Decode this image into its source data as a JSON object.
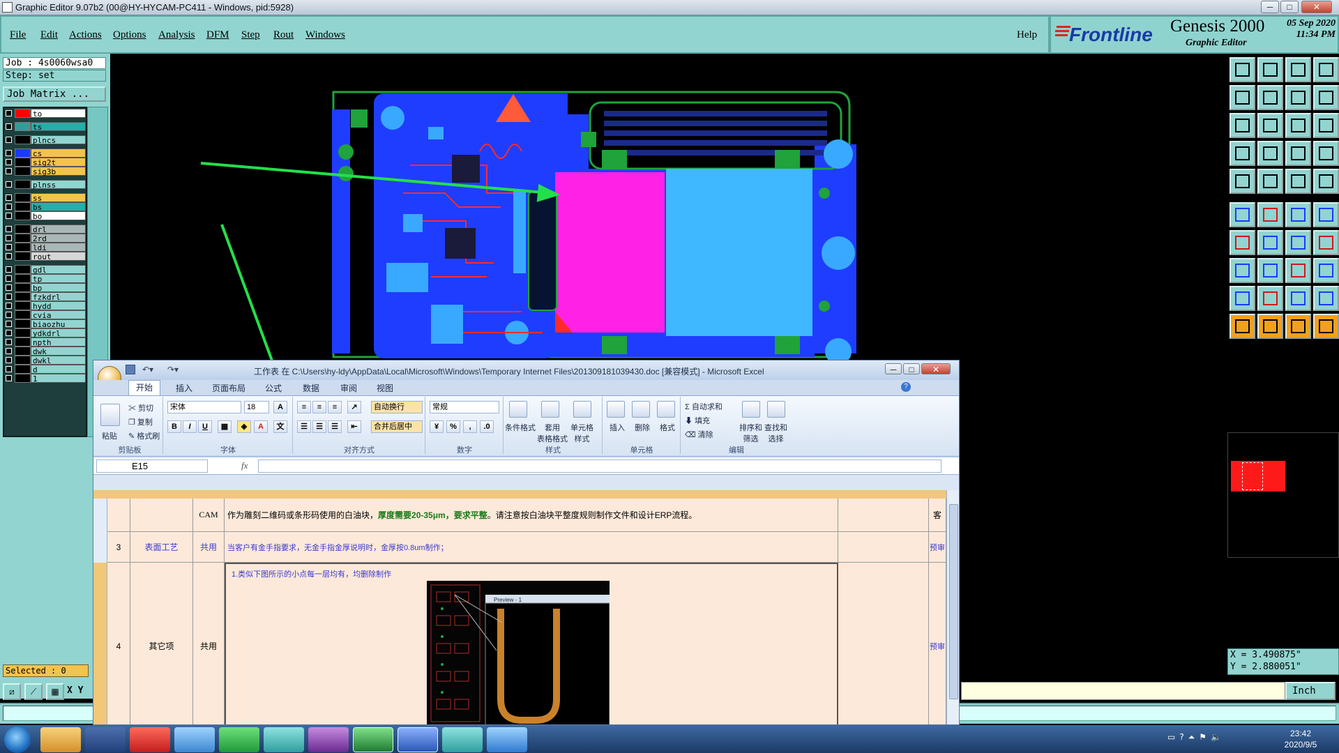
{
  "window": {
    "title": "Graphic Editor 9.07b2 (00@HY-HYCAM-PC411 - Windows, pid:5928)",
    "minimize": "─",
    "maximize": "□",
    "close": "✕"
  },
  "menu": {
    "items": [
      "File",
      "Edit",
      "Actions",
      "Options",
      "Analysis",
      "DFM",
      "Step",
      "Rout",
      "Windows"
    ],
    "help": "Help"
  },
  "brand": {
    "logo_text": "Frontline",
    "product": "Genesis 2000",
    "subtitle": "Graphic Editor",
    "date": "05  Sep  2020",
    "time": "11:34  PM"
  },
  "job": {
    "job_line": "Job : 4s0060wsa0",
    "step_line": "Step: set",
    "matrix_button": "Job Matrix ..."
  },
  "layers": [
    {
      "name": "to",
      "color": "#ff0000",
      "bg": "#ffffff"
    },
    {
      "name": "ts",
      "color": "#2aa198",
      "bg": "#22b0a8"
    },
    {
      "name": "plncs",
      "color": "#000000",
      "bg": "#92d4d0"
    },
    {
      "name": "cs",
      "color": "#1a3aff",
      "bg": "#f2c44e"
    },
    {
      "name": "sig2t",
      "color": "#000000",
      "bg": "#f2c44e"
    },
    {
      "name": "sig3b",
      "color": "#000000",
      "bg": "#f2c44e"
    },
    {
      "name": "plnss",
      "color": "#000000",
      "bg": "#92d4d0"
    },
    {
      "name": "ss",
      "color": "#000000",
      "bg": "#f2c44e"
    },
    {
      "name": "bs",
      "color": "#000000",
      "bg": "#22b0a8"
    },
    {
      "name": "bo",
      "color": "#000000",
      "bg": "#ffffff"
    },
    {
      "name": "drl",
      "color": "#000000",
      "bg": "#a9b7b6"
    },
    {
      "name": "2rd",
      "color": "#000000",
      "bg": "#a9b7b6"
    },
    {
      "name": "ldi",
      "color": "#000000",
      "bg": "#a9b7b6"
    },
    {
      "name": "rout",
      "color": "#000000",
      "bg": "#d6d6d6"
    },
    {
      "name": "gdl",
      "color": "#000000",
      "bg": "#92d4d0"
    },
    {
      "name": "tp",
      "color": "#000000",
      "bg": "#92d4d0"
    },
    {
      "name": "bp",
      "color": "#000000",
      "bg": "#92d4d0"
    },
    {
      "name": "fzkdrl",
      "color": "#000000",
      "bg": "#92d4d0"
    },
    {
      "name": "hydd",
      "color": "#000000",
      "bg": "#92d4d0"
    },
    {
      "name": "cvia",
      "color": "#000000",
      "bg": "#92d4d0"
    },
    {
      "name": "biaozhu",
      "color": "#000000",
      "bg": "#92d4d0"
    },
    {
      "name": "ydkdrl",
      "color": "#000000",
      "bg": "#92d4d0"
    },
    {
      "name": "npth",
      "color": "#000000",
      "bg": "#92d4d0"
    },
    {
      "name": "dwk",
      "color": "#000000",
      "bg": "#92d4d0"
    },
    {
      "name": "dwkl",
      "color": "#000000",
      "bg": "#92d4d0"
    },
    {
      "name": "d",
      "color": "#000000",
      "bg": "#92d4d0"
    },
    {
      "name": "1",
      "color": "#000000",
      "bg": "#92d4d0"
    }
  ],
  "status": {
    "selected": "Selected : 0",
    "xy_label": "X Y",
    "x": "X = 3.490875\"",
    "y": "Y = 2.880051\"",
    "units": "Inch"
  },
  "excel": {
    "title": "工作表 在 C:\\Users\\hy-ldy\\AppData\\Local\\Microsoft\\Windows\\Temporary Internet Files\\201309181039430.doc  [兼容模式]  -  Microsoft Excel",
    "tabs": [
      "开始",
      "插入",
      "页面布局",
      "公式",
      "数据",
      "审阅",
      "视图"
    ],
    "clipboard": {
      "paste": "粘贴",
      "cut": "剪切",
      "copy": "复制",
      "format_painter": "格式刷",
      "label": "剪贴板"
    },
    "font": {
      "name": "宋体",
      "size": "18",
      "label": "字体"
    },
    "align": {
      "wrap": "自动换行",
      "merge": "合并后居中",
      "label": "对齐方式"
    },
    "number": {
      "format": "常规",
      "label": "数字"
    },
    "styles": {
      "cond": "条件格式",
      "table": "套用\n表格格式",
      "cell": "单元格\n样式",
      "label": "样式"
    },
    "cells": {
      "insert": "插入",
      "delete": "删除",
      "format": "格式",
      "label": "单元格"
    },
    "edit": {
      "autosum": "自动求和",
      "fill": "填充",
      "clear": "清除",
      "sort": "排序和\n筛选",
      "find": "查找和\n选择",
      "label": "编辑"
    },
    "namebox": "E15",
    "fx": "fx",
    "rows": [
      {
        "num": "3",
        "a": "表面工艺",
        "b": "共用",
        "c": "当客户有金手指要求，无金手指金厚说明时，金厚按0.8um制作；",
        "d": "预审"
      },
      {
        "num": "4",
        "a": "其它项",
        "b": "共用",
        "c": "1.类似下图所示的小点每一层均有，均删除制作",
        "d": "预审"
      }
    ],
    "row_cam": {
      "b": "CAM",
      "c_pre": "作为雕刻二维码或条形码使用的白油块，",
      "c_bold": "厚度需要20-35μm，要求平整",
      "c_post": "。请注意按白油块平整度规则制作文件和设计ERP流程。",
      "d": "客"
    },
    "preview_caption": "Preview - 1"
  },
  "taskbar": {
    "clock_time": "23:42",
    "clock_date": "2020/9/5"
  }
}
